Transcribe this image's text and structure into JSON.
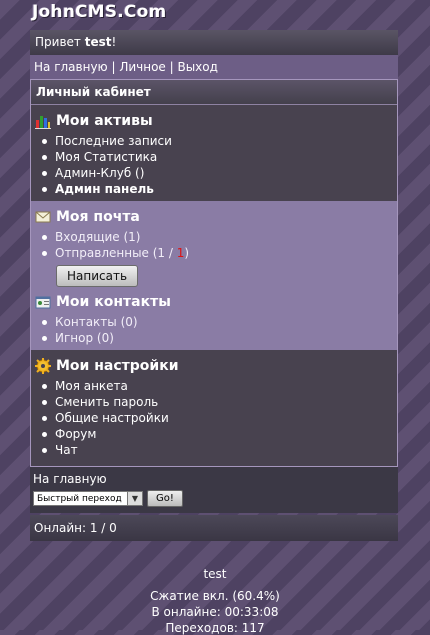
{
  "logo": "JohnCMS.Com",
  "greeting": {
    "prefix": "Привет ",
    "user": "test",
    "suffix": "!"
  },
  "topnav": {
    "home": "На главную",
    "sep": " | ",
    "personal": "Личное",
    "logout": "Выход"
  },
  "cabinet": {
    "title": "Личный кабинет"
  },
  "assets": {
    "title": "Мои активы",
    "items": [
      "Последние записи",
      "Моя Статистика"
    ],
    "admin_club": {
      "label": "Админ-Клуб (",
      "count": "",
      "close": ")"
    },
    "admin_panel": "Админ панель"
  },
  "mail": {
    "title": "Моя почта",
    "inbox": "Входящие (1)",
    "sent": {
      "label": "Отправленные (1 / ",
      "count": "1",
      "close": ")"
    },
    "write_button": "Написать"
  },
  "contacts": {
    "title": "Мои контакты",
    "items": [
      "Контакты (0)",
      "Игнор (0)"
    ]
  },
  "settings": {
    "title": "Мои настройки",
    "items": [
      "Моя анкета",
      "Сменить пароль",
      "Общие настройки",
      "Форум",
      "Чат"
    ]
  },
  "quick": {
    "home": "На главную",
    "select_value": "Быстрый переход",
    "go": "Go!"
  },
  "online": "Онлайн: 1 / 0",
  "footer": {
    "user": "test",
    "compression": "Сжатие вкл. (60.4%)",
    "online_time": "В онлайне: 00:33:08",
    "transitions": "Переходов: 117"
  },
  "colors": {
    "accent_red": "#e01010",
    "panel_light": "#8a7ca5",
    "panel_dark": "#48424f"
  }
}
